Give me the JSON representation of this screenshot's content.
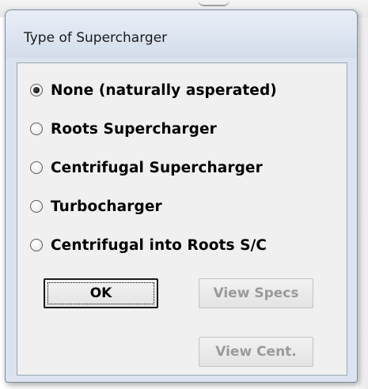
{
  "dialog": {
    "title": "Type of Supercharger"
  },
  "options": [
    {
      "label": "None (naturally asperated)",
      "selected": true
    },
    {
      "label": "Roots Supercharger",
      "selected": false
    },
    {
      "label": "Centrifugal Supercharger",
      "selected": false
    },
    {
      "label": "Turbocharger",
      "selected": false
    },
    {
      "label": "Centrifugal into Roots S/C",
      "selected": false
    }
  ],
  "buttons": {
    "ok_label": "OK",
    "view_specs_label": "View Specs",
    "view_cent_label": "View Cent."
  },
  "colors": {
    "frame": "#dbe3ee",
    "client": "#f0f0f0",
    "disabled_text": "#9a9a9a"
  }
}
